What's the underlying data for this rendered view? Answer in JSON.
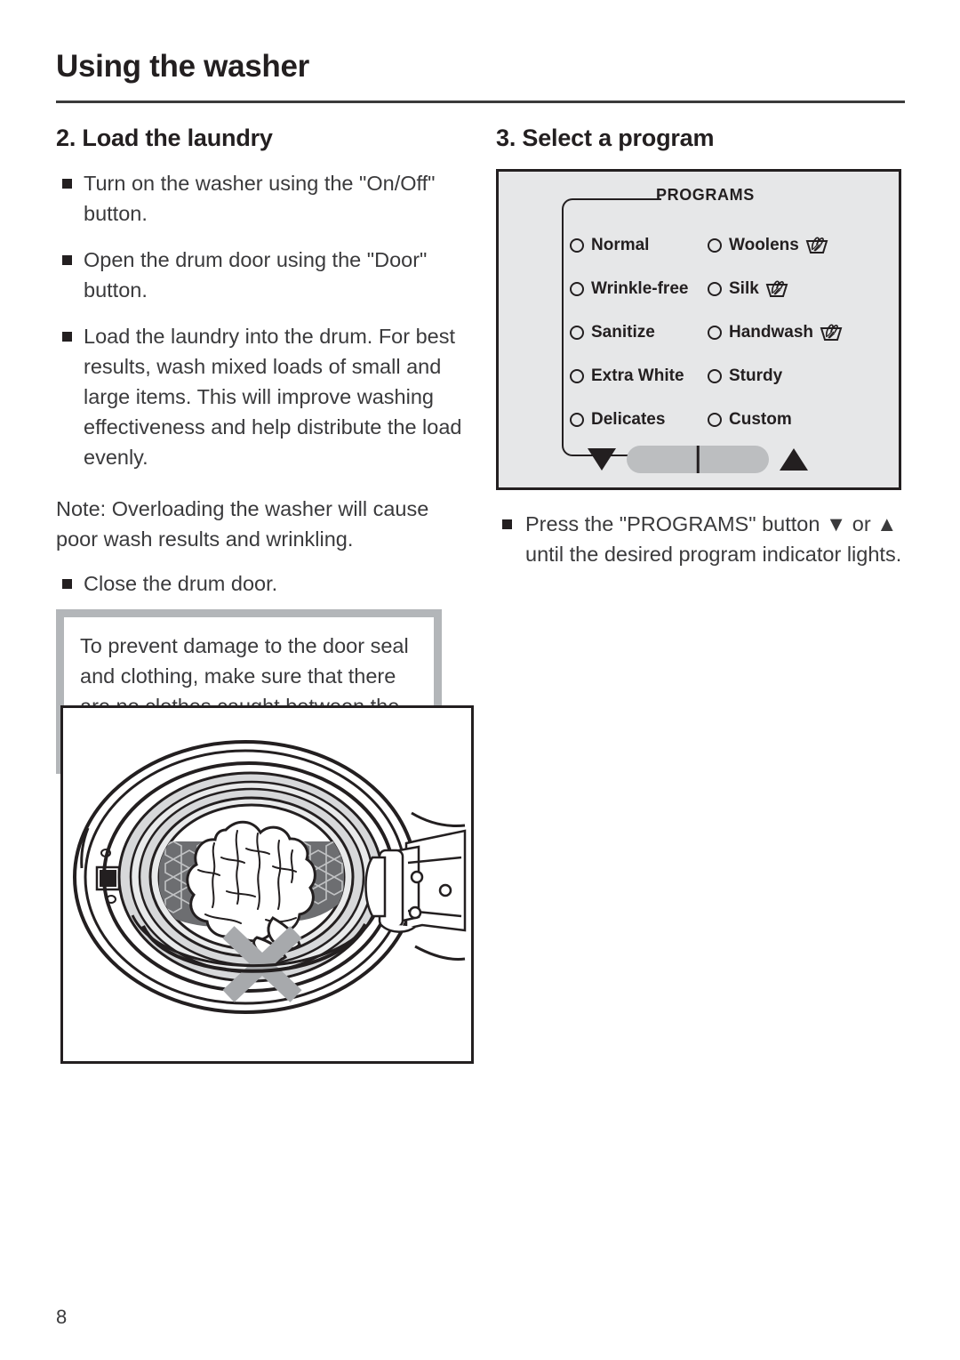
{
  "document": {
    "header_title": "Using the washer",
    "page_number": "8"
  },
  "left_column": {
    "heading": "2. Load the laundry",
    "bullets": [
      "Turn on the washer using the \"On/Off\" button.",
      "Open the drum door using the \"Door\" button.",
      "Load the laundry into the drum. For best results, wash mixed loads of small and large items. This will improve washing effectiveness and help distribute the load evenly."
    ],
    "note": "Note: Overloading the washer will cause poor wash results and wrinkling.",
    "bullet_after_note": "Close the drum door.",
    "warning_box": {
      "text": "To prevent damage to the door seal and clothing, make sure that there are no clothes caught between the drum door and the seal.",
      "border_color": "#b3b6b9"
    },
    "illustration": {
      "caption": "Open washer drum door with laundry caught in the door seal, marked with a gray X",
      "x_mark_color": "#a7a9ac"
    }
  },
  "right_column": {
    "heading": "3. Select a program",
    "panel": {
      "label": "PROGRAMS",
      "background_color": "#e6e7e8",
      "border_color": "#231f20",
      "programs": [
        {
          "label": "Normal",
          "symbol": "",
          "selected": false
        },
        {
          "label": "Woolens",
          "symbol": "hand-wash-symbol",
          "selected": false
        },
        {
          "label": "Wrinkle-free",
          "symbol": "",
          "selected": false
        },
        {
          "label": "Silk",
          "symbol": "hand-wash-symbol",
          "selected": false
        },
        {
          "label": "Sanitize",
          "symbol": "",
          "selected": false
        },
        {
          "label": "Handwash",
          "symbol": "hand-wash-symbol",
          "selected": false
        },
        {
          "label": "Extra White",
          "symbol": "",
          "selected": false
        },
        {
          "label": "Sturdy",
          "symbol": "",
          "selected": false
        },
        {
          "label": "Delicates",
          "symbol": "",
          "selected": false
        },
        {
          "label": "Custom",
          "symbol": "",
          "selected": false
        }
      ],
      "rocker": {
        "down_icon": "triangle-down-icon",
        "up_icon": "triangle-up-icon",
        "button_color": "#bcbec0"
      }
    },
    "instruction": "Press the \"PROGRAMS\" button ▼ or ▲ until the desired program indicator lights."
  }
}
